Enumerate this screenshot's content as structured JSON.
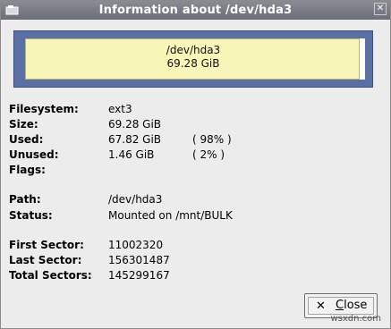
{
  "window": {
    "title": "Information about /dev/hda3"
  },
  "usage_bar": {
    "path": "/dev/hda3",
    "size": "69.28 GiB",
    "used_fraction": 0.98,
    "colors": {
      "frame": "#5a6fa3",
      "used": "#f8f5b8",
      "free": "#ffffff"
    }
  },
  "details": {
    "filesystem": {
      "label": "Filesystem:",
      "value": "ext3"
    },
    "size": {
      "label": "Size:",
      "value": "69.28 GiB"
    },
    "used": {
      "label": "Used:",
      "value": "67.82 GiB",
      "percent": "( 98% )"
    },
    "unused": {
      "label": "Unused:",
      "value": "1.46 GiB",
      "percent": "( 2% )"
    },
    "flags": {
      "label": "Flags:",
      "value": ""
    },
    "path": {
      "label": "Path:",
      "value": "/dev/hda3"
    },
    "status": {
      "label": "Status:",
      "value": "Mounted on /mnt/BULK"
    },
    "first_sector": {
      "label": "First Sector:",
      "value": "11002320"
    },
    "last_sector": {
      "label": "Last Sector:",
      "value": "156301487"
    },
    "total_sectors": {
      "label": "Total Sectors:",
      "value": "145299167"
    }
  },
  "buttons": {
    "close": {
      "icon": "close-icon",
      "label_first": "C",
      "label_rest": "lose"
    }
  },
  "watermark": "wsxdn.com"
}
